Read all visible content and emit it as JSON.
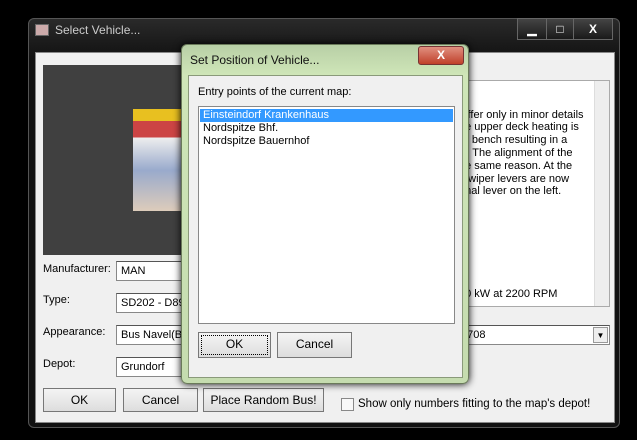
{
  "main_window": {
    "title": "Select Vehicle...",
    "controls": {
      "minimize": "▁",
      "maximize": "□",
      "close": "X"
    },
    "labels": {
      "manufacturer": "Manufacturer:",
      "type": "Type:",
      "appearance": "Appearance:",
      "depot": "Depot:"
    },
    "fields": {
      "manufacturer": "MAN",
      "type": "SD202 - D89",
      "appearance": "Bus Navel(By",
      "depot": "Grundorf",
      "number": "3708"
    },
    "description_lines": [
      "differ only in minor details",
      "he upper deck heating is",
      "ar bench resulting in a",
      "w. The alignment of the",
      "he same reason. At the",
      "d wiper levers are now",
      "onal lever on the left.",
      "",
      "",
      "",
      "",
      "",
      "",
      "",
      "50 kW at 2200 RPM"
    ],
    "buttons": {
      "ok": "OK",
      "cancel": "Cancel",
      "random": "Place Random Bus!"
    },
    "checkbox_label": "Show only numbers fitting to the map's depot!",
    "checkbox_checked": false
  },
  "dialog": {
    "title": "Set Position of Vehicle...",
    "close": "X",
    "label": "Entry points of the current map:",
    "entries": [
      "Einsteindorf Krankenhaus",
      "Nordspitze Bhf.",
      "Nordspitze Bauernhof"
    ],
    "selected_index": 0,
    "buttons": {
      "ok": "OK",
      "cancel": "Cancel"
    }
  }
}
